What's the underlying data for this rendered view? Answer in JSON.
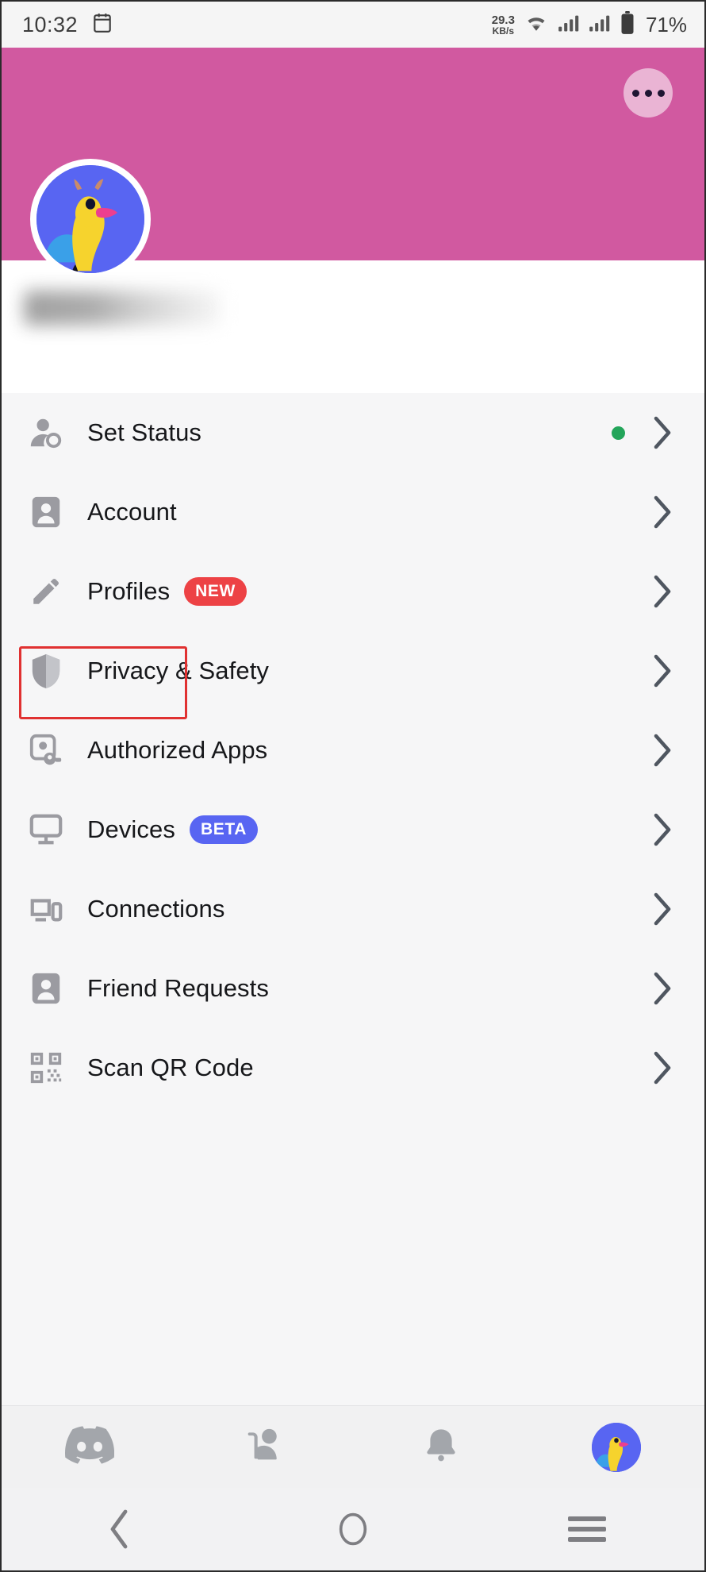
{
  "status_bar": {
    "time": "10:32",
    "calendar_icon": "calendar-icon",
    "net_speed_value": "29.3",
    "net_speed_unit": "KB/s",
    "wifi_icon": "wifi-icon",
    "signal_icon_1": "cellular-signal-icon",
    "signal_icon_2": "cellular-signal-icon",
    "battery_icon": "battery-icon",
    "battery_percent": "71%"
  },
  "banner": {
    "color": "#d159a0",
    "more_button": "overflow-menu-button"
  },
  "profile": {
    "avatar": "user-avatar",
    "username": "",
    "username_redacted": true
  },
  "settings_list": [
    {
      "id": "set-status",
      "icon": "person-status-icon",
      "label": "Set Status",
      "badge": null,
      "badge_type": null,
      "status_dot": true,
      "status_dot_color": "#23a55a",
      "chevron": "chevron-right-icon"
    },
    {
      "id": "account",
      "icon": "account-card-icon",
      "label": "Account",
      "badge": null,
      "badge_type": null,
      "status_dot": false,
      "highlighted": true,
      "chevron": "chevron-right-icon"
    },
    {
      "id": "profiles",
      "icon": "pencil-icon",
      "label": "Profiles",
      "badge": "NEW",
      "badge_type": "new",
      "status_dot": false,
      "chevron": "chevron-right-icon"
    },
    {
      "id": "privacy-safety",
      "icon": "shield-icon",
      "label": "Privacy & Safety",
      "badge": null,
      "badge_type": null,
      "status_dot": false,
      "chevron": "chevron-right-icon"
    },
    {
      "id": "authorized-apps",
      "icon": "authorized-apps-icon",
      "label": "Authorized Apps",
      "badge": null,
      "badge_type": null,
      "status_dot": false,
      "chevron": "chevron-right-icon"
    },
    {
      "id": "devices",
      "icon": "monitor-icon",
      "label": "Devices",
      "badge": "BETA",
      "badge_type": "beta",
      "status_dot": false,
      "chevron": "chevron-right-icon"
    },
    {
      "id": "connections",
      "icon": "devices-connections-icon",
      "label": "Connections",
      "badge": null,
      "badge_type": null,
      "status_dot": false,
      "chevron": "chevron-right-icon"
    },
    {
      "id": "friend-requests",
      "icon": "person-card-icon",
      "label": "Friend Requests",
      "badge": null,
      "badge_type": null,
      "status_dot": false,
      "chevron": "chevron-right-icon"
    },
    {
      "id": "scan-qr-code",
      "icon": "qr-code-icon",
      "label": "Scan QR Code",
      "badge": null,
      "badge_type": null,
      "status_dot": false,
      "chevron": "chevron-right-icon"
    }
  ],
  "highlight": {
    "color": "#e03131",
    "target": "Account"
  },
  "bottom_tabs": [
    {
      "id": "servers",
      "icon": "discord-logo-icon",
      "label": ""
    },
    {
      "id": "friends",
      "icon": "friends-icon",
      "label": ""
    },
    {
      "id": "notifications",
      "icon": "bell-icon",
      "label": ""
    },
    {
      "id": "you",
      "icon": "user-avatar-icon",
      "label": "",
      "active": true
    }
  ],
  "android_nav": [
    {
      "id": "back",
      "icon": "back-chevron-icon"
    },
    {
      "id": "home",
      "icon": "home-circle-icon"
    },
    {
      "id": "recents",
      "icon": "recents-menu-icon"
    }
  ]
}
